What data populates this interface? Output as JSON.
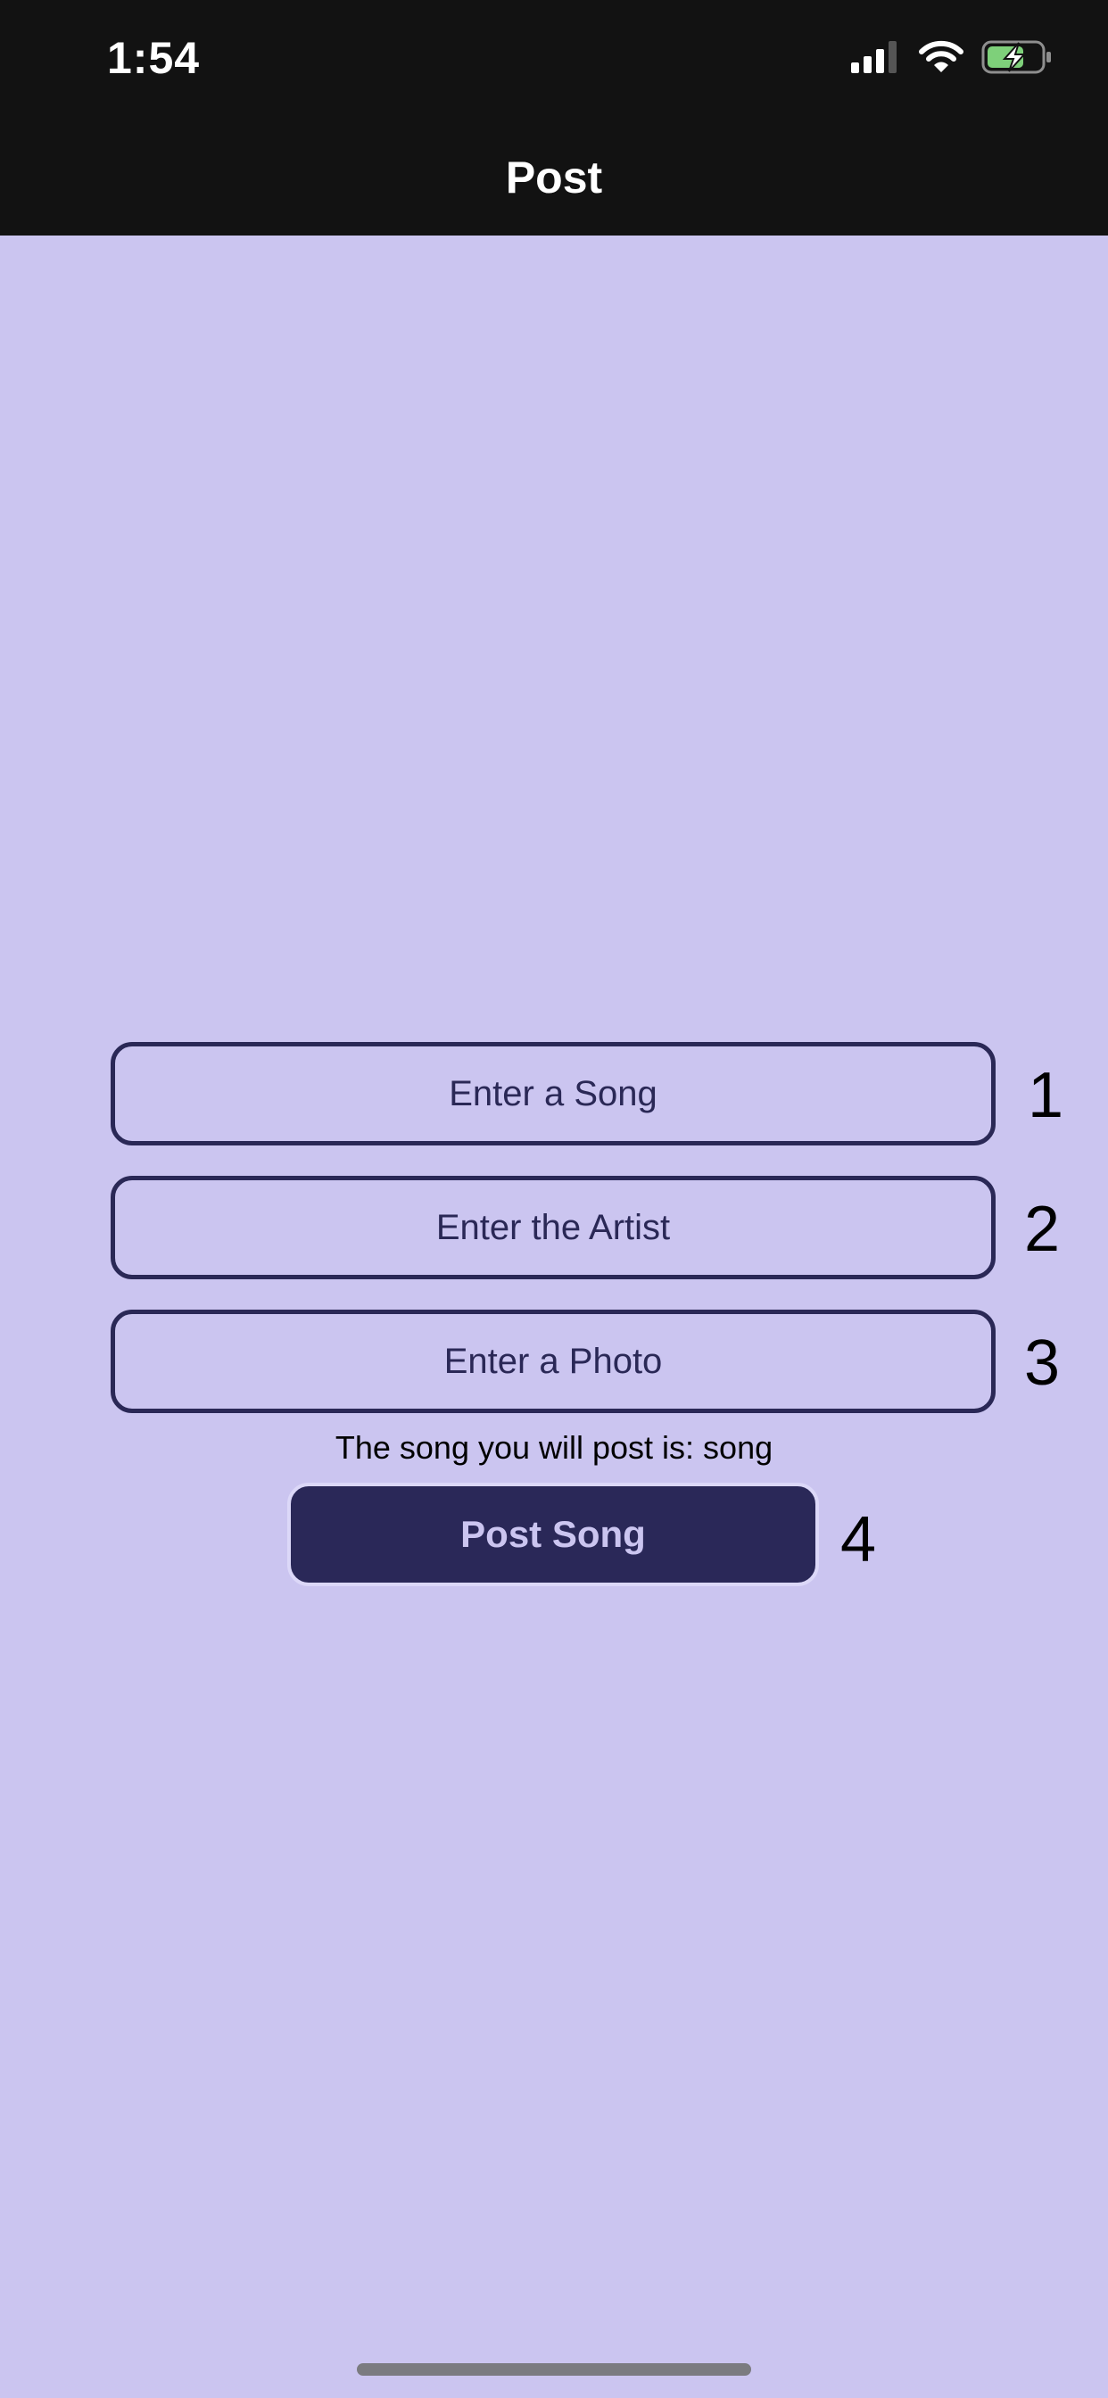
{
  "status_bar": {
    "time": "1:54",
    "icons": [
      "cellular-signal-icon",
      "wifi-icon",
      "battery-charging-icon"
    ]
  },
  "nav": {
    "title": "Post"
  },
  "form": {
    "song_placeholder": "Enter a Song",
    "artist_placeholder": "Enter the Artist",
    "photo_placeholder": "Enter a Photo",
    "preview_text": "The song you will post is: song",
    "post_button_label": "Post Song"
  },
  "annotations": [
    "1",
    "2",
    "3",
    "4"
  ],
  "colors": {
    "background": "#cbc5f0",
    "bar": "#121212",
    "accent": "#2a2858",
    "battery_fill": "#7ed07a"
  }
}
